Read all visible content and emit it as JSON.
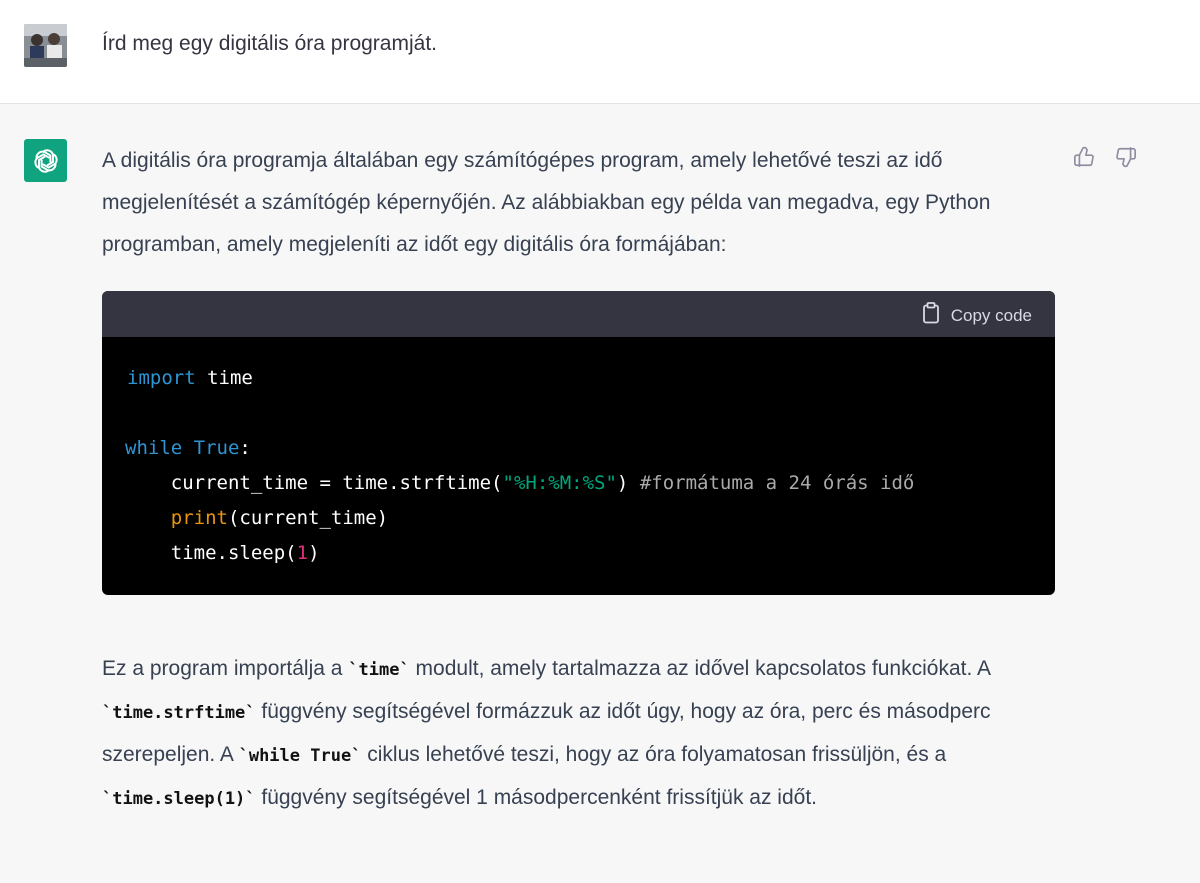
{
  "user": {
    "message": "Írd meg egy digitális óra programját."
  },
  "assistant": {
    "intro": "A digitális óra programja általában egy számítógépes program, amely lehetővé teszi az idő megjelenítését a számítógép képernyőjén. Az alábbiakban egy példa van megadva, egy Python programban, amely megjeleníti az időt egy digitális óra formájában:",
    "code_block": {
      "copy_label": "Copy code",
      "line1": {
        "kw": "import",
        "rest": " time"
      },
      "line3": {
        "kw1": "while",
        "sp": " ",
        "kw2": "True",
        "rest": ":"
      },
      "line4": {
        "indent": "    ",
        "a": "current_time = time.strftime(",
        "q1": "\"",
        "str": "%H:%M:%S",
        "q2": "\"",
        "b": ") ",
        "comment": "#formátuma a 24 órás idő"
      },
      "line5": {
        "indent": "    ",
        "fn": "print",
        "rest": "(current_time)"
      },
      "line6": {
        "indent": "    ",
        "a": "time.sleep(",
        "num": "1",
        "b": ")"
      }
    },
    "explanation": {
      "t1": "Ez a program importálja a ",
      "c1": "`time`",
      "t2": " modult, amely tartalmazza az idővel kapcsolatos funkciókat. A ",
      "c2": "`time.strftime`",
      "t3": " függvény segítségével formázzuk az időt úgy, hogy az óra, perc és másodperc szerepeljen. A ",
      "c3": "`while True`",
      "t4": " ciklus lehetővé teszi, hogy az óra folyamatosan frissüljön, és a ",
      "c4": "`time.sleep(1)`",
      "t5": " függvény segítségével 1 másodpercenként frissítjük az időt."
    }
  },
  "colors": {
    "brand": "#10a37f",
    "code_keyword": "#2e95d3",
    "code_string": "#00a67d",
    "code_function": "#e9950c",
    "code_number": "#df3079"
  },
  "icons": [
    "user-avatar",
    "openai-logo-icon",
    "thumbs-up-icon",
    "thumbs-down-icon",
    "clipboard-icon"
  ]
}
